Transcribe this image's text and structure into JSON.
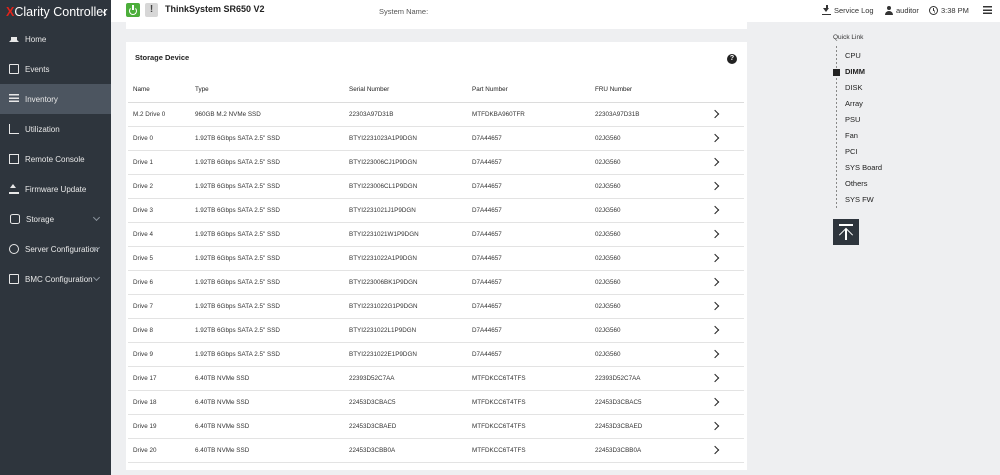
{
  "brand": {
    "x": "X",
    "rest": "Clarity Controller"
  },
  "sidebar": {
    "items": [
      {
        "label": "Home",
        "icon": "home-icon"
      },
      {
        "label": "Events",
        "icon": "events-icon"
      },
      {
        "label": "Inventory",
        "icon": "inventory-icon"
      },
      {
        "label": "Utilization",
        "icon": "utilization-icon"
      },
      {
        "label": "Remote Console",
        "icon": "remote-console-icon"
      },
      {
        "label": "Firmware Update",
        "icon": "firmware-update-icon"
      },
      {
        "label": "Storage",
        "icon": "storage-icon"
      },
      {
        "label": "Server Configuration",
        "icon": "server-configuration-icon"
      },
      {
        "label": "BMC Configuration",
        "icon": "bmc-configuration-icon"
      }
    ]
  },
  "header": {
    "model": "ThinkSystem SR650 V2",
    "system_name_label": "System Name:",
    "service_log": "Service Log",
    "user": "auditor",
    "time": "3:38 PM",
    "warning_glyph": "!"
  },
  "storage": {
    "title": "Storage Device",
    "help_glyph": "?",
    "columns": [
      "Name",
      "Type",
      "Serial Number",
      "Part Number",
      "FRU Number"
    ],
    "rows": [
      [
        "M.2 Drive 0",
        "960GB M.2 NVMe SSD",
        "22303A97D31B",
        "MTFDKBA960TFR",
        "22303A97D31B"
      ],
      [
        "Drive 0",
        "1.92TB 6Gbps SATA 2.5\" SSD",
        "BTYI2231023A1P9DGN",
        "D7A44657",
        "02JG560"
      ],
      [
        "Drive 1",
        "1.92TB 6Gbps SATA 2.5\" SSD",
        "BTYI223006CJ1P9DGN",
        "D7A44657",
        "02JG560"
      ],
      [
        "Drive 2",
        "1.92TB 6Gbps SATA 2.5\" SSD",
        "BTYI223006CL1P9DGN",
        "D7A44657",
        "02JG560"
      ],
      [
        "Drive 3",
        "1.92TB 6Gbps SATA 2.5\" SSD",
        "BTYI2231021J1P9DGN",
        "D7A44657",
        "02JG560"
      ],
      [
        "Drive 4",
        "1.92TB 6Gbps SATA 2.5\" SSD",
        "BTYI2231021W1P9DGN",
        "D7A44657",
        "02JG560"
      ],
      [
        "Drive 5",
        "1.92TB 6Gbps SATA 2.5\" SSD",
        "BTYI2231022A1P9DGN",
        "D7A44657",
        "02JG560"
      ],
      [
        "Drive 6",
        "1.92TB 6Gbps SATA 2.5\" SSD",
        "BTYI223006BK1P9DGN",
        "D7A44657",
        "02JG560"
      ],
      [
        "Drive 7",
        "1.92TB 6Gbps SATA 2.5\" SSD",
        "BTYI2231022G1P9DGN",
        "D7A44657",
        "02JG560"
      ],
      [
        "Drive 8",
        "1.92TB 6Gbps SATA 2.5\" SSD",
        "BTYI2231022L1P9DGN",
        "D7A44657",
        "02JG560"
      ],
      [
        "Drive 9",
        "1.92TB 6Gbps SATA 2.5\" SSD",
        "BTYI2231022E1P9DGN",
        "D7A44657",
        "02JG560"
      ],
      [
        "Drive 17",
        "6.40TB NVMe SSD",
        "22393D52C7AA",
        "MTFDKCC6T4TFS",
        "22393D52C7AA"
      ],
      [
        "Drive 18",
        "6.40TB NVMe SSD",
        "22453D3CBAC5",
        "MTFDKCC6T4TFS",
        "22453D3CBAC5"
      ],
      [
        "Drive 19",
        "6.40TB NVMe SSD",
        "22453D3CBAED",
        "MTFDKCC6T4TFS",
        "22453D3CBAED"
      ],
      [
        "Drive 20",
        "6.40TB NVMe SSD",
        "22453D3CBB0A",
        "MTFDKCC6T4TFS",
        "22453D3CBB0A"
      ]
    ]
  },
  "quick_link": {
    "title": "Quick Link",
    "items": [
      "CPU",
      "DIMM",
      "DISK",
      "Array",
      "PSU",
      "Fan",
      "PCI",
      "SYS Board",
      "Others",
      "SYS FW"
    ],
    "active_index": 1
  },
  "colors": {
    "sidebar_bg": "#2e353d",
    "active_item": "#4c5560",
    "power_green": "#4cae3a",
    "brand_red": "#e2231a"
  }
}
